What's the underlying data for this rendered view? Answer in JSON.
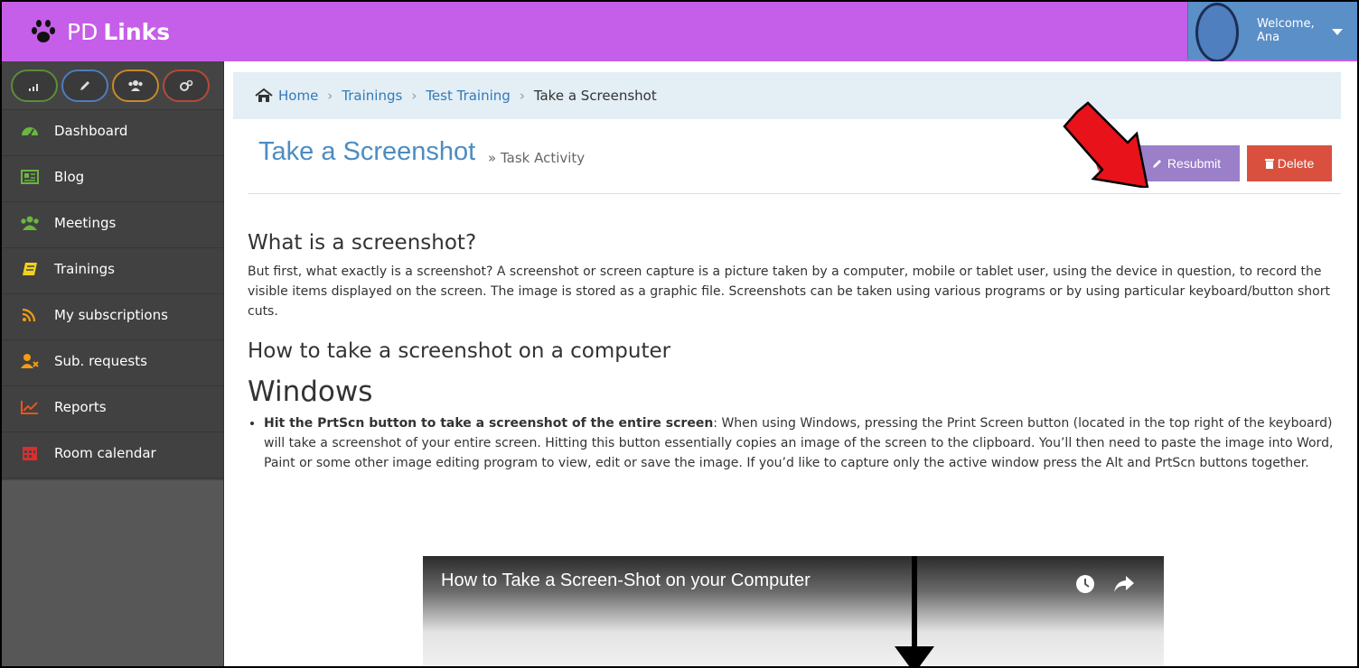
{
  "brand": {
    "prefix": "PD",
    "strong": "Links"
  },
  "user": {
    "welcome": "Welcome,",
    "name": "Ana"
  },
  "sidebar": {
    "quick_buttons": [
      "stats-icon",
      "pencil-icon",
      "group-icon",
      "cogs-icon"
    ],
    "items": [
      {
        "label": "Dashboard",
        "icon": "dashboard-icon"
      },
      {
        "label": "Blog",
        "icon": "newspaper-icon"
      },
      {
        "label": "Meetings",
        "icon": "group-icon"
      },
      {
        "label": "Trainings",
        "icon": "book-icon"
      },
      {
        "label": "My subscriptions",
        "icon": "rss-icon"
      },
      {
        "label": "Sub. requests",
        "icon": "user-times-icon"
      },
      {
        "label": "Reports",
        "icon": "line-chart-icon"
      },
      {
        "label": "Room calendar",
        "icon": "calendar-icon"
      }
    ]
  },
  "breadcrumb": {
    "home": "Home",
    "trainings": "Trainings",
    "test": "Test Training",
    "current": "Take a Screenshot"
  },
  "page": {
    "title": "Take a Screenshot",
    "subtitle": "» Task Activity",
    "resubmit": "Resubmit",
    "delete": "Delete"
  },
  "content": {
    "h_what": "What is a screenshot?",
    "p_what": "But first, what exactly is a screenshot? A screenshot or screen capture is a picture taken by a computer, mobile or tablet user, using the device in question, to record the visible items displayed on the screen. The image is stored as a graphic file. Screenshots can be taken using various programs or by using particular keyboard/button short cuts.",
    "h_how": "How to take a screenshot on a computer",
    "h_windows": "Windows",
    "li_strong": "Hit the PrtScn button to take a screenshot of the entire screen",
    "li_text": ": When using Windows, pressing the Print Screen button (located in the top right of the keyboard) will take a screenshot of your entire screen. Hitting this button essentially copies an image of the screen to the clipboard. You’ll then need to paste the image into Word, Paint or some other image editing program to view, edit or save the image. If you’d like to capture only the active window press the Alt and PrtScn buttons together."
  },
  "video": {
    "title": "How to Take a Screen-Shot on your Computer"
  },
  "colors": {
    "topbar": "#c55ee8",
    "sidebar": "#444444",
    "resubmit": "#9b7fc8",
    "delete": "#d9503f",
    "link": "#337ab7"
  }
}
